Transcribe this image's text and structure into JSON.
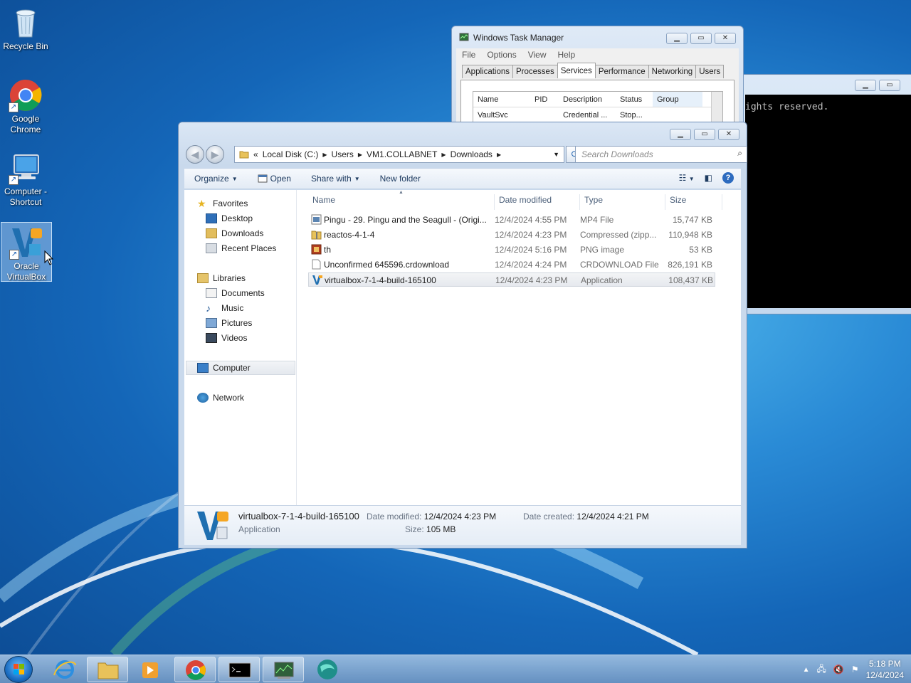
{
  "desktop": {
    "icons": [
      {
        "label": "Recycle Bin"
      },
      {
        "label": "Google Chrome"
      },
      {
        "label": "Computer - Shortcut"
      },
      {
        "label": "Oracle VirtualBox"
      }
    ]
  },
  "console": {
    "text": "ights reserved."
  },
  "task_manager": {
    "title": "Windows Task Manager",
    "menu": [
      "File",
      "Options",
      "View",
      "Help"
    ],
    "tabs": [
      "Applications",
      "Processes",
      "Services",
      "Performance",
      "Networking",
      "Users"
    ],
    "active_tab": "Services",
    "columns": [
      "Name",
      "PID",
      "Description",
      "Status",
      "Group"
    ],
    "rows": [
      {
        "name": "VaultSvc",
        "pid": "",
        "description": "Credential ...",
        "status": "Stop..."
      }
    ]
  },
  "explorer": {
    "address": {
      "lead": "«",
      "crumbs": [
        "Local Disk (C:)",
        "Users",
        "VM1.COLLABNET",
        "Downloads"
      ]
    },
    "search_placeholder": "Search Downloads",
    "toolbar": {
      "organize": "Organize",
      "open": "Open",
      "share_with": "Share with",
      "new_folder": "New folder"
    },
    "nav": {
      "favorites": "Favorites",
      "desktop": "Desktop",
      "downloads": "Downloads",
      "recent_places": "Recent Places",
      "libraries": "Libraries",
      "documents": "Documents",
      "music": "Music",
      "pictures": "Pictures",
      "videos": "Videos",
      "computer": "Computer",
      "network": "Network"
    },
    "columns": {
      "name": "Name",
      "date_modified": "Date modified",
      "type": "Type",
      "size": "Size"
    },
    "files": [
      {
        "name": "Pingu - 29. Pingu and the Seagull - (Origi...",
        "date": "12/4/2024 4:55 PM",
        "type": "MP4 File",
        "size": "15,747 KB",
        "icon": "video-file-icon"
      },
      {
        "name": "reactos-4-1-4",
        "date": "12/4/2024 4:23 PM",
        "type": "Compressed (zipp...",
        "size": "110,948 KB",
        "icon": "zip-folder-icon"
      },
      {
        "name": "th",
        "date": "12/4/2024 5:16 PM",
        "type": "PNG image",
        "size": "53 KB",
        "icon": "image-file-icon"
      },
      {
        "name": "Unconfirmed 645596.crdownload",
        "date": "12/4/2024 4:24 PM",
        "type": "CRDOWNLOAD File",
        "size": "826,191 KB",
        "icon": "blank-file-icon"
      },
      {
        "name": "virtualbox-7-1-4-build-165100",
        "date": "12/4/2024 4:23 PM",
        "type": "Application",
        "size": "108,437 KB",
        "icon": "virtualbox-icon"
      }
    ],
    "selected_file_index": 4,
    "details": {
      "name": "virtualbox-7-1-4-build-165100",
      "kind": "Application",
      "date_modified_label": "Date modified:",
      "date_modified": "12/4/2024 4:23 PM",
      "date_created_label": "Date created:",
      "date_created": "12/4/2024 4:21 PM",
      "size_label": "Size:",
      "size": "105 MB"
    }
  },
  "taskbar": {
    "time": "5:18 PM",
    "date": "12/4/2024"
  },
  "colors": {
    "explorer_frame": "#c9d9ec",
    "selection": "#e6e9ee",
    "toolbar_text": "#1e3b60",
    "console_bg": "#000000"
  }
}
